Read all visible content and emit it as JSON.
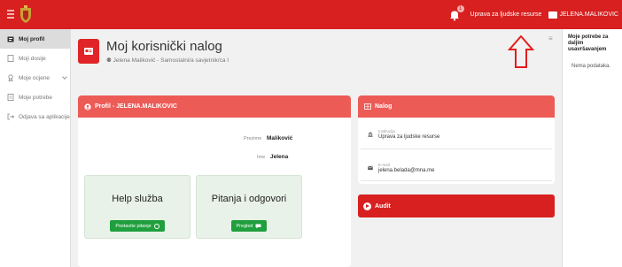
{
  "topbar": {
    "notification_count": "1",
    "institution": "Uprava za ljudske resurse",
    "user": "JELENA.MALIKOVIC"
  },
  "sidebar": {
    "items": [
      {
        "label": "Moj profil",
        "icon": "id-card-icon"
      },
      {
        "label": "Moji dosije",
        "icon": "folder-icon"
      },
      {
        "label": "Moje ocjene",
        "icon": "badge-icon"
      },
      {
        "label": "Moje potrebe",
        "icon": "document-icon"
      },
      {
        "label": "Odjava sa aplikacije",
        "icon": "logout-icon"
      }
    ]
  },
  "header": {
    "title": "Moj korisnički nalog",
    "subtitle": "Jelena Maliković - Samostalni/a savjetnik/ca I"
  },
  "profile": {
    "heading": "Profil - JELENA.MALIKOVIC",
    "surname_label": "Prezime",
    "surname": "Maliković",
    "name_label": "Ime",
    "name": "Jelena"
  },
  "tiles": {
    "help_title": "Help služba",
    "help_button": "Postavite pitanje",
    "faq_title": "Pitanja i odgovori",
    "faq_button": "Pregled"
  },
  "nalog": {
    "heading": "Nalog",
    "institution_label": "Institucija",
    "institution": "Uprava za ljudske resurse",
    "email_label": "E-mail",
    "email": "jelena.belada@mna.me"
  },
  "audit": {
    "heading": "Audit"
  },
  "right_panel": {
    "title": "Moje potrebe za daljim usavršavanjem",
    "empty": "Nema podataka."
  },
  "colors": {
    "brand_red": "#d7201f",
    "card_head": "#ed5b57",
    "button_green": "#1f9f3d"
  }
}
